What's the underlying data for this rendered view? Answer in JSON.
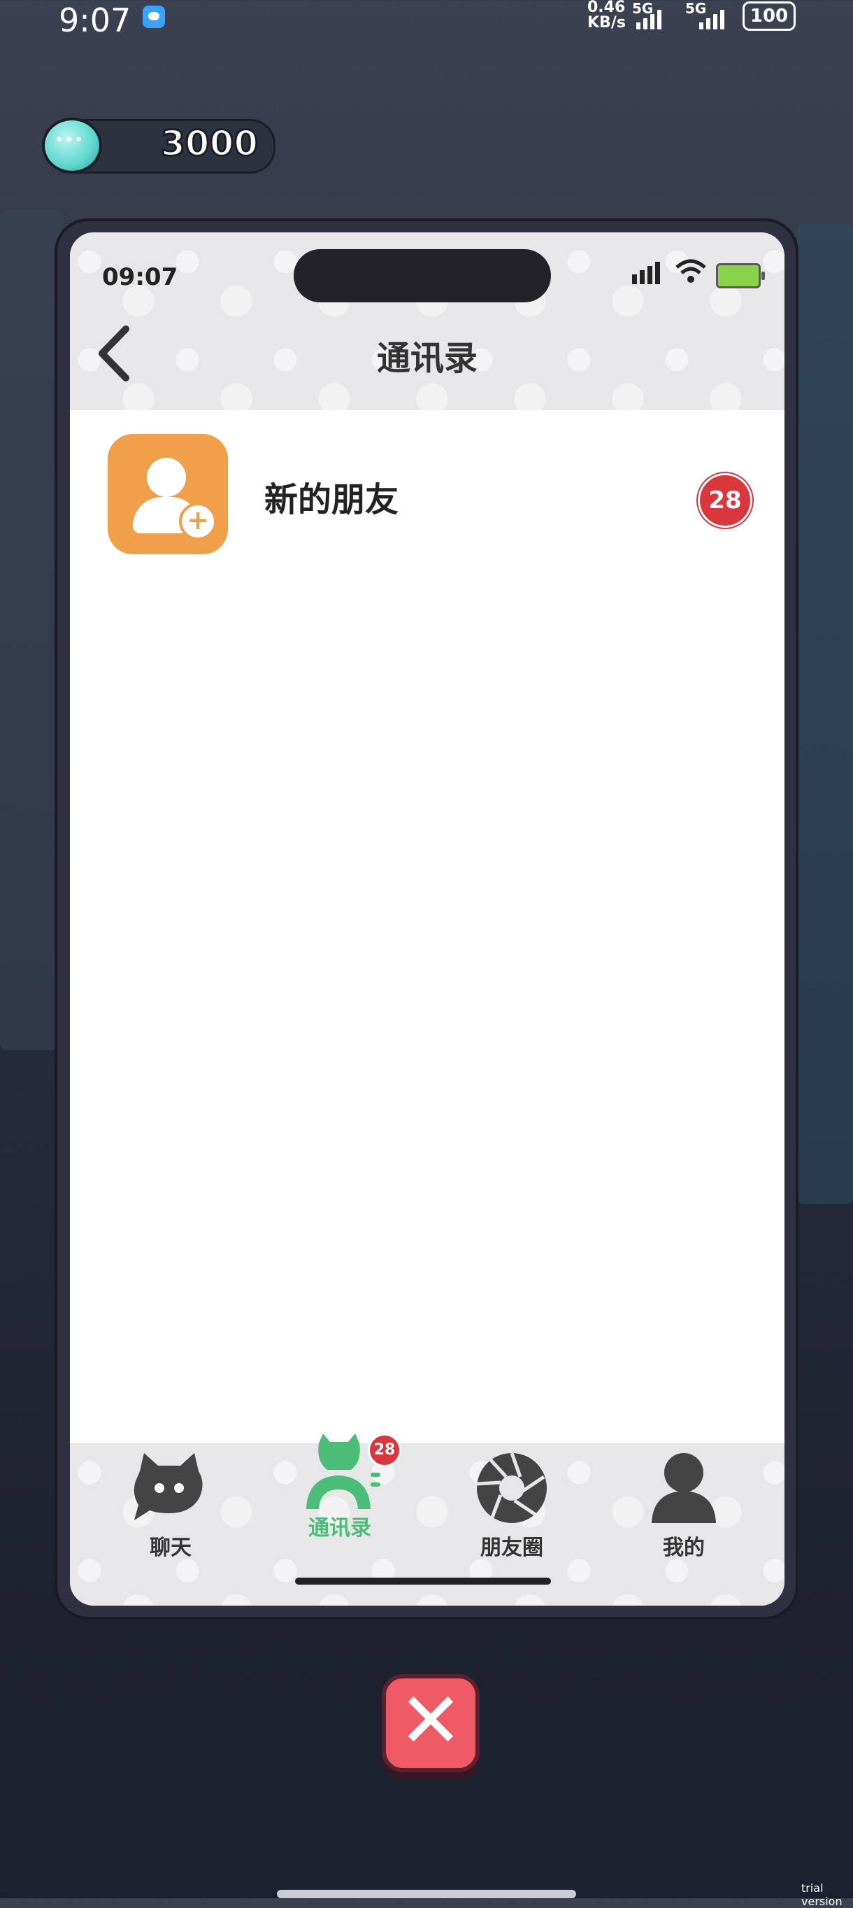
{
  "system_status": {
    "time": "9:07",
    "net_speed_value": "0.46",
    "net_speed_unit": "KB/s",
    "signal_1_label": "5G",
    "signal_2_label": "5G",
    "battery": "100"
  },
  "coins": {
    "value": "3000"
  },
  "phone": {
    "status_time": "09:07",
    "nav": {
      "title": "通讯录"
    },
    "contacts": [
      {
        "name": "新的朋友",
        "badge": "28",
        "icon": "add-friend-icon"
      }
    ],
    "tabs": [
      {
        "label": "聊天",
        "icon": "chat-cat-icon",
        "active": false
      },
      {
        "label": "通讯录",
        "icon": "contacts-icon",
        "active": true,
        "badge": "28"
      },
      {
        "label": "朋友圈",
        "icon": "moments-aperture-icon",
        "active": false
      },
      {
        "label": "我的",
        "icon": "profile-icon",
        "active": false
      }
    ]
  },
  "colors": {
    "accent_green": "#4cbd79",
    "badge_red": "#d9363e",
    "avatar_orange": "#f0a04b"
  },
  "watermark": "trial version"
}
